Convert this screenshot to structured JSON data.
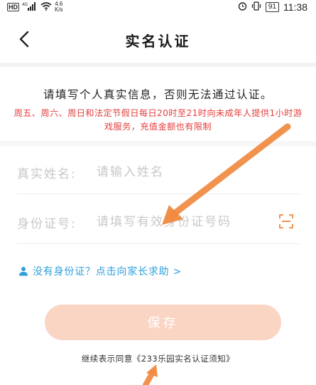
{
  "status_bar": {
    "left_hd": "HD",
    "signal": "4G",
    "speed_value": "4.6",
    "speed_unit": "K/s",
    "battery": "91",
    "time": "11:38"
  },
  "nav": {
    "title": "实名认证"
  },
  "notice": {
    "main": "请填写个人真实信息，否则无法通过认证。",
    "restriction": "周五、周六、周日和法定节假日每日20时至21时向未成年人提供1小时游戏服务，充值金额也有限制"
  },
  "form": {
    "name_label": "真实姓名:",
    "name_placeholder": "请输入姓名",
    "id_label": "身份证号:",
    "id_placeholder": "请填写有效身份证号码"
  },
  "help": {
    "text": "没有身份证？点击向家长求助 >"
  },
  "save": {
    "label": "保存"
  },
  "agreement": {
    "prefix": "继续表示同意",
    "link": "《233乐园实名认证须知》"
  },
  "colors": {
    "accent_red": "#e53d3d",
    "link_blue": "#2f9fdc",
    "button_disabled": "#fbd5c4",
    "annotation_arrow": "#f0893f"
  }
}
